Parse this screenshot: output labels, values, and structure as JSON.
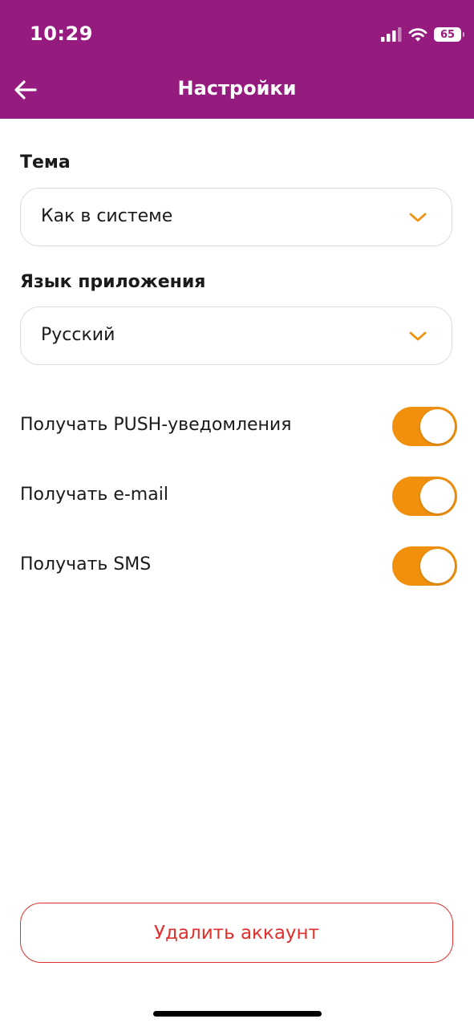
{
  "status_bar": {
    "time": "10:29",
    "battery": "65",
    "icons": [
      "cellular-signal-icon",
      "wifi-icon",
      "battery-icon"
    ]
  },
  "header": {
    "title": "Настройки",
    "back_icon": "arrow-left-icon",
    "background": "#961b7f"
  },
  "theme": {
    "label": "Тема",
    "value": "Как в системе"
  },
  "language": {
    "label": "Язык приложения",
    "value": "Русский"
  },
  "toggles": [
    {
      "label": "Получать PUSH-уведомления",
      "on": true
    },
    {
      "label": "Получать e-mail",
      "on": true
    },
    {
      "label": "Получать SMS",
      "on": true
    }
  ],
  "delete_account": {
    "label": "Удалить аккаунт"
  },
  "colors": {
    "accent": "#f0900d",
    "danger": "#e0302c",
    "brand": "#961b7f"
  }
}
